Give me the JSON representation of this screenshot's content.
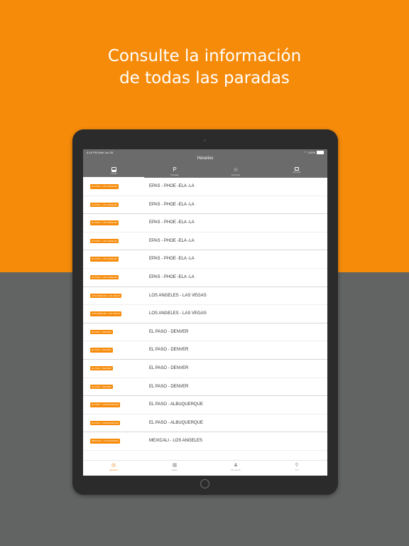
{
  "promo": {
    "headline_line1": "Consulte la información",
    "headline_line2": "de todas las paradas"
  },
  "colors": {
    "brand_orange": "#f68b0a",
    "background_gray": "#616462",
    "header_gray": "#6b6b6b",
    "device_frame": "#2b2b2b"
  },
  "status_bar": {
    "time_date": "6:18 PM   Wed Jan 26",
    "battery": "100%"
  },
  "header": {
    "title": "Horarios",
    "tabs": [
      {
        "icon": "bus-icon",
        "label": "Líneas"
      },
      {
        "icon": "parking-icon",
        "glyph": "P",
        "label": "Paradas"
      },
      {
        "icon": "star-icon",
        "glyph": "☆",
        "label": "Favoritos"
      },
      {
        "icon": "alarm-icon",
        "label": "Alarmas"
      }
    ]
  },
  "routes": [
    {
      "badge": "EL PASO - LOS ANGELES",
      "name": "EPAS - PHOE -ELA -LA"
    },
    {
      "badge": "EL PASO - LOS ANGELES",
      "name": "EPAS - PHOE -ELA -LA"
    },
    {
      "badge": "EL PASO - LOS ANGELES",
      "name": "EPAS - PHOE -ELA -LA"
    },
    {
      "badge": "EL PASO - LOS ANGELES",
      "name": "EPAS - PHOE -ELA -LA"
    },
    {
      "badge": "EL PASO - LOS ANGELES",
      "name": "EPAS - PHOE -ELA -LA"
    },
    {
      "badge": "EL PASO - LOS ANGELES",
      "name": "EPAS - PHOE -ELA -LA"
    },
    {
      "badge": "LOS ANGELES - LAS VEGAS",
      "name": "LOS ANGELES - LAS VEGAS"
    },
    {
      "badge": "LOS ANGELES - LAS VEGAS",
      "name": "LOS ANGELES - LAS VEGAS"
    },
    {
      "badge": "EL PASO - DENVER",
      "name": "EL PASO - DENVER"
    },
    {
      "badge": "EL PASO - DENVER",
      "name": "EL PASO - DENVER"
    },
    {
      "badge": "EL PASO - DENVER",
      "name": "EL PASO - DENVER"
    },
    {
      "badge": "EL PASO - DENVER",
      "name": "EL PASO - DENVER"
    },
    {
      "badge": "EL PASO - ALBUQUERQUE",
      "name": "EL PASO - ALBUQUERQUE"
    },
    {
      "badge": "EL PASO - ALBUQUERQUE",
      "name": "EL PASO - ALBUQUERQUE"
    },
    {
      "badge": "MEXICALI - LOS ANGELES",
      "name": "MEXICALI - LOS ANGELES"
    }
  ],
  "bottom_tabs": [
    {
      "icon": "clock-icon",
      "glyph": "◎",
      "label": "Horarios"
    },
    {
      "icon": "map-icon",
      "glyph": "▦",
      "label": "Mapa"
    },
    {
      "icon": "account-icon",
      "glyph": "♟",
      "label": "Mi cuenta"
    },
    {
      "icon": "info-icon",
      "glyph": "⚲",
      "label": "Info"
    }
  ]
}
